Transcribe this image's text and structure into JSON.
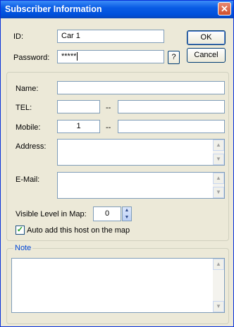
{
  "window": {
    "title": "Subscriber Information",
    "close_glyph": "✕"
  },
  "form": {
    "id_label": "ID:",
    "id_value": "Car 1",
    "password_label": "Password:",
    "password_value": "*****",
    "help_glyph": "?",
    "ok_label": "OK",
    "cancel_label": "Cancel",
    "name_label": "Name:",
    "name_value": "",
    "tel_label": "TEL:",
    "tel_part1": "",
    "tel_sep": "--",
    "tel_part2": "",
    "mobile_label": "Mobile:",
    "mobile_part1": "1",
    "mobile_sep": "--",
    "mobile_part2": "",
    "address_label": "Address:",
    "address_value": "",
    "email_label": "E-Mail:",
    "email_value": "",
    "visible_level_label": "Visible Level in Map:",
    "visible_level_value": "0",
    "auto_add_label": "Auto add this host on the map",
    "auto_add_checked": true,
    "note_legend": "Note",
    "note_value": ""
  },
  "icons": {
    "scroll_up": "scroll-up-arrow-icon",
    "scroll_down": "scroll-down-arrow-icon",
    "spin_up": "spin-up-icon",
    "spin_down": "spin-down-icon",
    "check": "checkmark-icon",
    "close": "close-icon"
  },
  "colors": {
    "titlebar": "#0a5ce4",
    "dialog_bg": "#ece9d8",
    "close_button": "#d04f2c",
    "note_legend": "#0046d5"
  }
}
